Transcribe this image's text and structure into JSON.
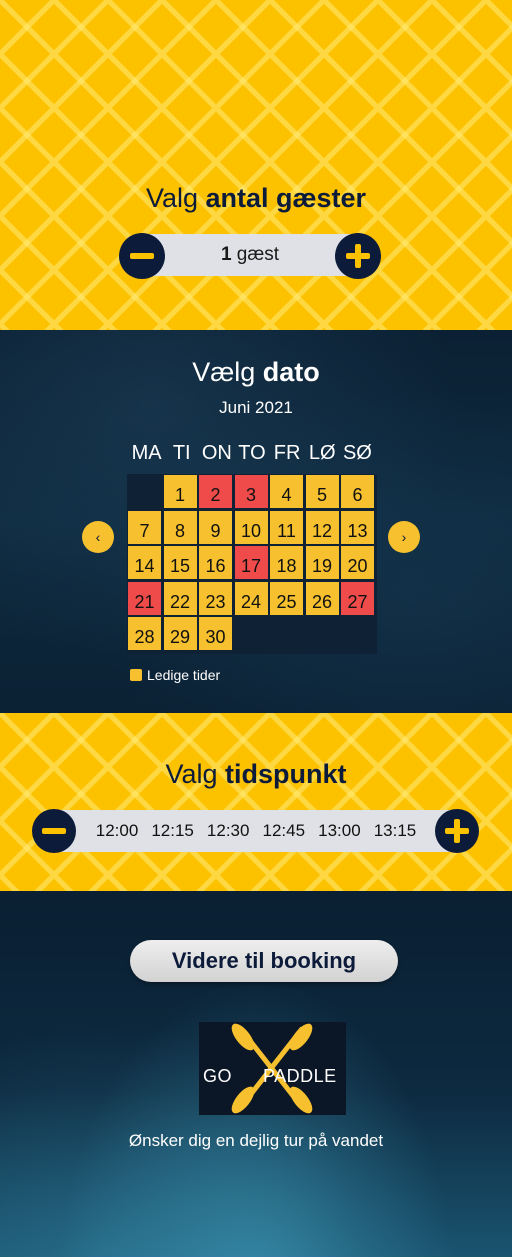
{
  "guests": {
    "heading_pre": "Valg",
    "heading_bold": "antal gæster",
    "count": "1",
    "unit": "gæst"
  },
  "date": {
    "heading_pre": "Vælg",
    "heading_bold": "dato",
    "month": "Juni 2021",
    "weekdays": [
      "MA",
      "TI",
      "ON",
      "TO",
      "FR",
      "LØ",
      "SØ"
    ],
    "prev_arrow": "‹",
    "next_arrow": "›",
    "legend": "Ledige tider",
    "days": [
      {
        "d": "1",
        "s": "free"
      },
      {
        "d": "2",
        "s": "busy"
      },
      {
        "d": "3",
        "s": "busy"
      },
      {
        "d": "4",
        "s": "free"
      },
      {
        "d": "5",
        "s": "free"
      },
      {
        "d": "6",
        "s": "free"
      },
      {
        "d": "7",
        "s": "free"
      },
      {
        "d": "8",
        "s": "free"
      },
      {
        "d": "9",
        "s": "free"
      },
      {
        "d": "10",
        "s": "free"
      },
      {
        "d": "11",
        "s": "free"
      },
      {
        "d": "12",
        "s": "free"
      },
      {
        "d": "13",
        "s": "free"
      },
      {
        "d": "14",
        "s": "free"
      },
      {
        "d": "15",
        "s": "free"
      },
      {
        "d": "16",
        "s": "free"
      },
      {
        "d": "17",
        "s": "busy"
      },
      {
        "d": "18",
        "s": "free"
      },
      {
        "d": "19",
        "s": "free"
      },
      {
        "d": "20",
        "s": "free"
      },
      {
        "d": "21",
        "s": "busy"
      },
      {
        "d": "22",
        "s": "free"
      },
      {
        "d": "23",
        "s": "free"
      },
      {
        "d": "24",
        "s": "free"
      },
      {
        "d": "25",
        "s": "free"
      },
      {
        "d": "26",
        "s": "free"
      },
      {
        "d": "27",
        "s": "busy"
      },
      {
        "d": "28",
        "s": "free"
      },
      {
        "d": "29",
        "s": "free"
      },
      {
        "d": "30",
        "s": "free"
      }
    ]
  },
  "time": {
    "heading_pre": "Valg",
    "heading_bold": "tidspunkt",
    "slots": [
      "12:00",
      "12:15",
      "12:30",
      "12:45",
      "13:00",
      "13:15"
    ]
  },
  "cta": {
    "label": "Videre til booking"
  },
  "logo": {
    "left": "GO",
    "right": "PADDLE"
  },
  "tagline": "Ønsker dig en dejlig tur på vandet",
  "colors": {
    "yellow": "#fcc200",
    "navy": "#0d1b3a",
    "busy": "#ef4b4b",
    "free": "#f6c02e"
  },
  "icons": [
    "minus-icon",
    "plus-icon",
    "chevron-left-icon",
    "chevron-right-icon",
    "paddle-icon"
  ]
}
